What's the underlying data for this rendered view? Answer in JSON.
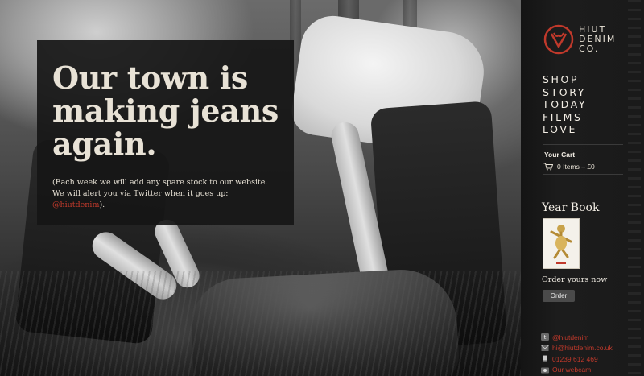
{
  "hero": {
    "headline": "Our town is making jeans again.",
    "notice_prefix": "(Each week we will add any spare stock to our website.  We will alert you via Twitter when it goes up: ",
    "notice_link": "@hiutdenim",
    "notice_suffix": ")."
  },
  "brand": {
    "logo_text": "HIUT DENIM CO.",
    "accent_color": "#c0392b"
  },
  "nav": {
    "items": [
      "SHOP",
      "STORY",
      "TODAY",
      "FILMS",
      "LOVE"
    ]
  },
  "cart": {
    "title": "Your Cart",
    "summary": "0 Items – £0",
    "icon": "cart-icon"
  },
  "yearbook": {
    "title": "Year Book",
    "order_text": "Order yours now",
    "order_button": "Order"
  },
  "contacts": [
    {
      "icon": "twitter-icon",
      "text": "@hiutdenim"
    },
    {
      "icon": "mail-icon",
      "text": "hi@hiutdenim.co.uk"
    },
    {
      "icon": "phone-icon",
      "text": "01239 612 469"
    },
    {
      "icon": "webcam-icon",
      "text": "Our webcam"
    }
  ]
}
